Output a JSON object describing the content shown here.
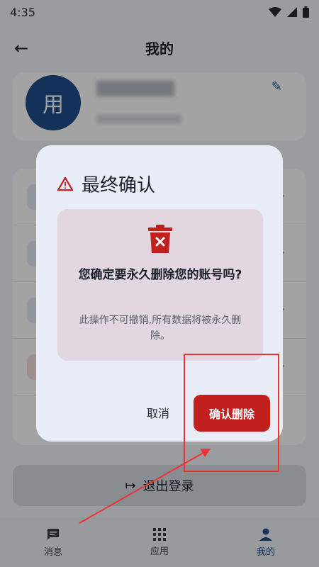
{
  "status_bar": {
    "time": "4:35"
  },
  "app_bar": {
    "title": "我的"
  },
  "profile": {
    "avatar_text": "用"
  },
  "logout": {
    "label": "退出登录"
  },
  "bottom_nav": [
    {
      "label": "消息",
      "icon": "message-icon"
    },
    {
      "label": "应用",
      "icon": "grid-icon"
    },
    {
      "label": "我的",
      "icon": "person-icon",
      "active": true
    }
  ],
  "dialog": {
    "title": "最终确认",
    "question": "您确定要永久删除您的账号吗?",
    "description": "此操作不可撤销,所有数据将被永久删除。",
    "cancel_label": "取消",
    "confirm_label": "确认删除"
  },
  "colors": {
    "accent": "#1f4d8c",
    "danger": "#c21f1f",
    "dialog_bg": "#e9edf8",
    "warning_box_bg": "#e2d6e0",
    "annotation": "#ee3333"
  }
}
